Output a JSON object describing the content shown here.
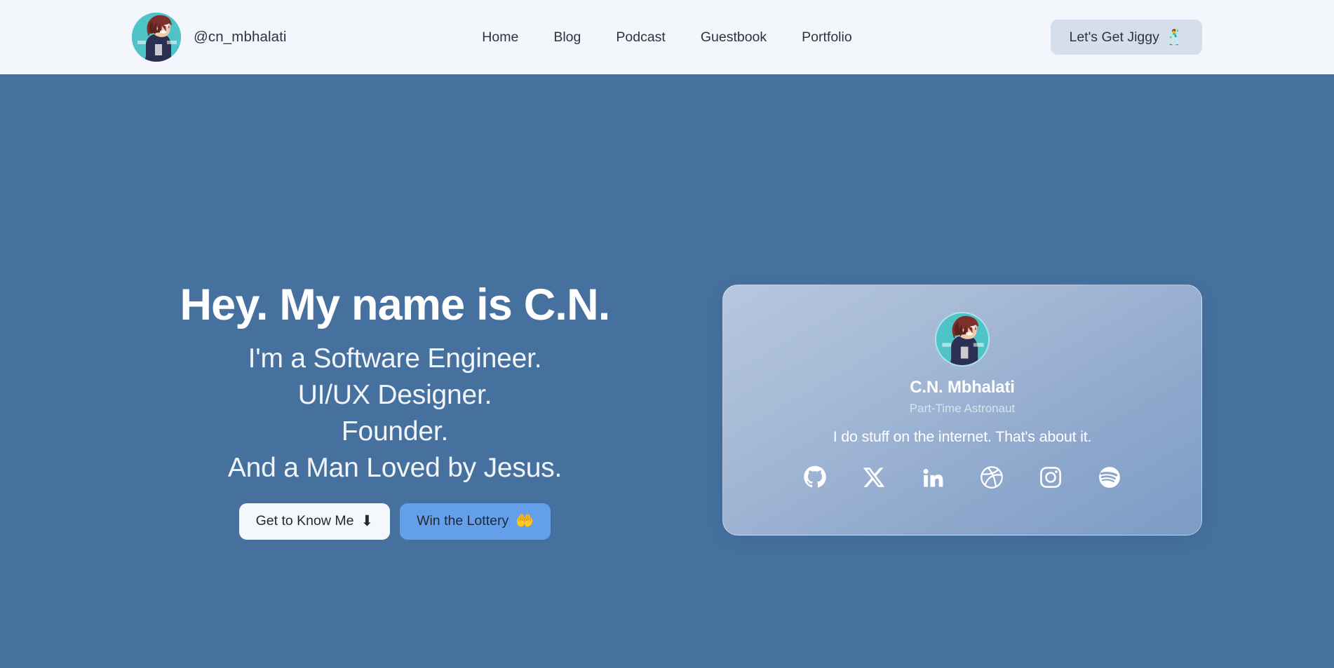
{
  "header": {
    "brand": {
      "handle": "@cn_mbhalati",
      "avatar_icon": "profile-avatar-anime"
    },
    "nav": [
      {
        "label": "Home"
      },
      {
        "label": "Blog"
      },
      {
        "label": "Podcast"
      },
      {
        "label": "Guestbook"
      },
      {
        "label": "Portfolio"
      }
    ],
    "cta": {
      "label": "Let's Get Jiggy",
      "emoji": "🕺",
      "background": "#d5dfec"
    }
  },
  "hero": {
    "background": "#46719f",
    "title": "Hey. My name is C.N.",
    "subtitle_lines": [
      "I'm a Software Engineer.",
      "UI/UX Designer.",
      "Founder.",
      "And a Man Loved by Jesus."
    ],
    "buttons": [
      {
        "label": "Get to Know Me",
        "emoji": "⬇",
        "style": "light",
        "background": "#f4f7fb"
      },
      {
        "label": "Win the Lottery",
        "emoji": "🤲",
        "style": "blue",
        "background": "#64a0ea"
      }
    ]
  },
  "profile_card": {
    "avatar_icon": "profile-avatar-anime",
    "name": "C.N. Mbhalati",
    "role": "Part-Time Astronaut",
    "bio": "I do stuff on the internet. That's about it.",
    "socials": [
      {
        "name": "github",
        "label": "GitHub"
      },
      {
        "name": "x",
        "label": "X"
      },
      {
        "name": "linkedin",
        "label": "LinkedIn"
      },
      {
        "name": "dribbble",
        "label": "Dribbble"
      },
      {
        "name": "instagram",
        "label": "Instagram"
      },
      {
        "name": "spotify",
        "label": "Spotify"
      }
    ]
  }
}
